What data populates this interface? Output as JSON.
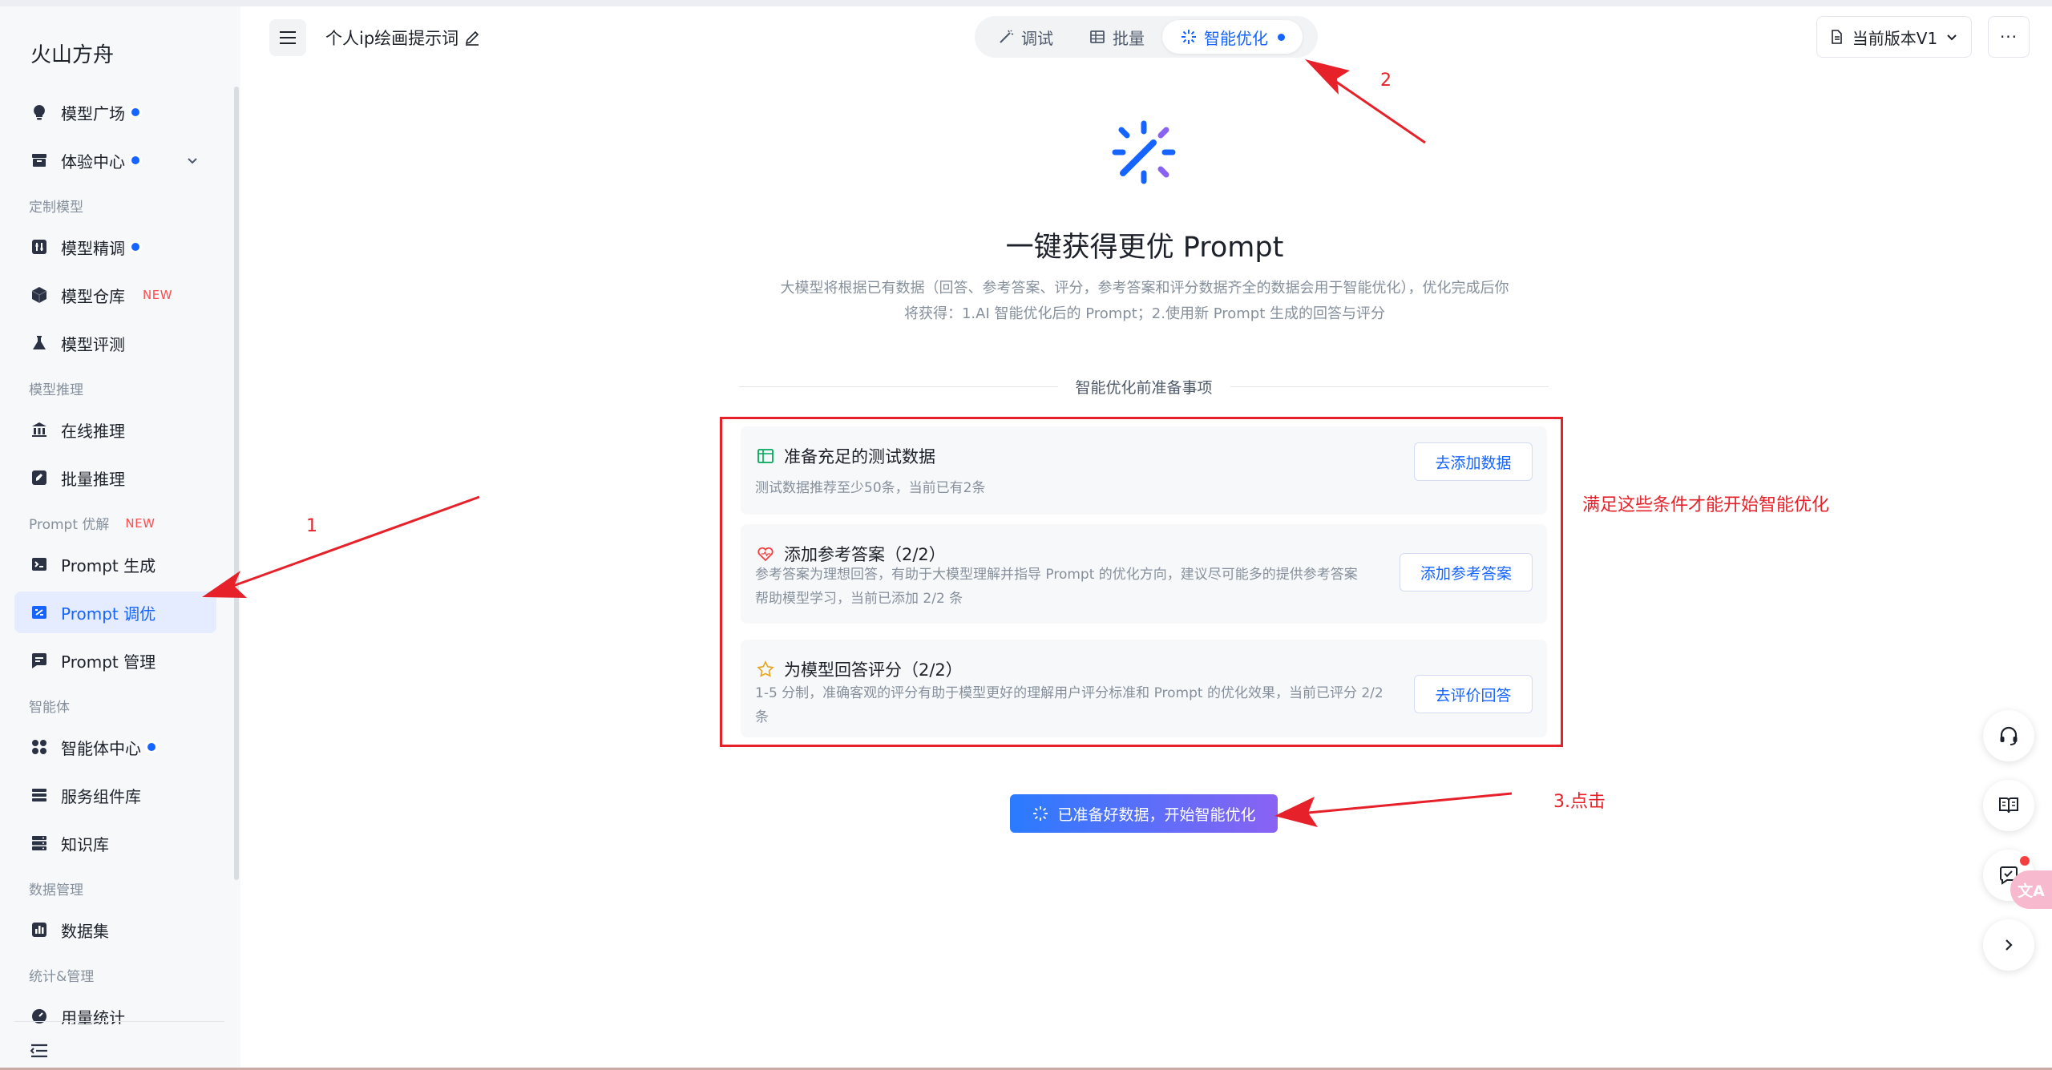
{
  "sidebar": {
    "brand": "火山方舟",
    "items": [
      {
        "label": "模型广场",
        "icon": "bulb-icon"
      },
      {
        "label": "体验中心",
        "icon": "box-icon"
      },
      {
        "label": "模型精调",
        "icon": "tune-icon"
      },
      {
        "label": "模型仓库",
        "icon": "cube-icon",
        "tag": "NEW"
      },
      {
        "label": "模型评测",
        "icon": "flask-icon"
      },
      {
        "label": "在线推理",
        "icon": "bank-icon"
      },
      {
        "label": "批量推理",
        "icon": "rocket-icon"
      },
      {
        "label": "Prompt 生成",
        "icon": "terminal-icon"
      },
      {
        "label": "Prompt 调优",
        "icon": "tune-prompt-icon"
      },
      {
        "label": "Prompt 管理",
        "icon": "message-icon"
      },
      {
        "label": "智能体中心",
        "icon": "apps-icon"
      },
      {
        "label": "服务组件库",
        "icon": "stack-icon"
      },
      {
        "label": "知识库",
        "icon": "server-icon"
      },
      {
        "label": "数据集",
        "icon": "bar-icon"
      },
      {
        "label": "用量统计",
        "icon": "gauge-icon"
      }
    ],
    "sections": {
      "custom_model": "定制模型",
      "model_inference": "模型推理",
      "prompt_opt": "Prompt 优解",
      "prompt_opt_tag": "NEW",
      "agent": "智能体",
      "data_mgmt": "数据管理",
      "stats": "统计&管理"
    }
  },
  "header": {
    "title": "个人ip绘画提示词",
    "tabs": [
      "调试",
      "批量",
      "智能优化"
    ],
    "active_tab": "智能优化",
    "version_label": "当前版本V1",
    "more_label": "···"
  },
  "main": {
    "title": "一键获得更优 Prompt",
    "desc_line1": "大模型将根据已有数据（回答、参考答案、评分，参考答案和评分数据齐全的数据会用于智能优化），优化完成后你",
    "desc_line2": "将获得：1.AI 智能优化后的 Prompt；2.使用新 Prompt 生成的回答与评分",
    "divider_label": "智能优化前准备事项",
    "cards": [
      {
        "title": "准备充足的测试数据",
        "desc1": "测试数据推荐至少50条，当前已有2条",
        "desc2": "",
        "button": "去添加数据"
      },
      {
        "title": "添加参考答案（2/2）",
        "desc1": "参考答案为理想回答，有助于大模型理解并指导 Prompt 的优化方向，建议尽可能多的提供参考答案",
        "desc2": "帮助模型学习，当前已添加 2/2 条",
        "button": "添加参考答案"
      },
      {
        "title": "为模型回答评分（2/2）",
        "desc1": "1-5 分制，准确客观的评分有助于模型更好的理解用户评分标准和 Prompt 的优化效果，当前已评分 2/2",
        "desc2": "条",
        "button": "去评价回答"
      }
    ],
    "start_button": "已准备好数据，开始智能优化"
  },
  "annotations": {
    "a1": "1",
    "a2": "2",
    "a3": "3.点击",
    "condition_note": "满足这些条件才能开始智能优化"
  },
  "floating": {
    "translate_label": "文A"
  },
  "colors": {
    "accent": "#1664ff",
    "annotation_red": "#e6212a",
    "sidebar_bg": "#f6f8fa",
    "active_bg": "#e5ecff"
  }
}
